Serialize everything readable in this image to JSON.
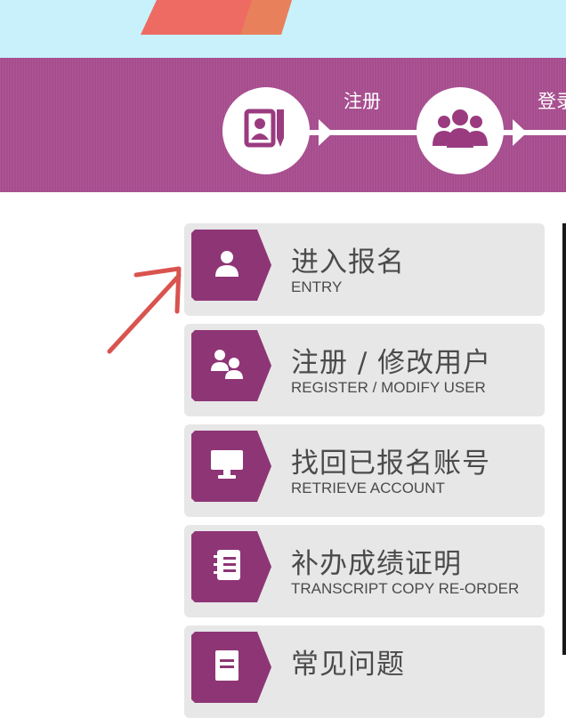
{
  "colors": {
    "banner_bg": "#c8f1fb",
    "purple_band": "#a74d8e",
    "badge_purple": "#8e3576",
    "card_bg": "#e7e7e7",
    "pointer_red": "#d9534f"
  },
  "steps": [
    {
      "label": "注册",
      "icon": "profile-card-pen-icon"
    },
    {
      "label": "登录",
      "icon": "users-group-icon"
    }
  ],
  "menu": {
    "items": [
      {
        "title": "进入报名",
        "subtitle": "ENTRY",
        "icon": "user-icon"
      },
      {
        "title": "注册 / 修改用户",
        "subtitle": "REGISTER / MODIFY USER",
        "icon": "users-icon"
      },
      {
        "title": "找回已报名账号",
        "subtitle": "RETRIEVE ACCOUNT",
        "icon": "monitor-icon"
      },
      {
        "title": "补办成绩证明",
        "subtitle": "TRANSCRIPT COPY RE-ORDER",
        "icon": "notebook-icon"
      },
      {
        "title": "常见问题",
        "subtitle": "",
        "icon": "document-icon"
      }
    ]
  }
}
